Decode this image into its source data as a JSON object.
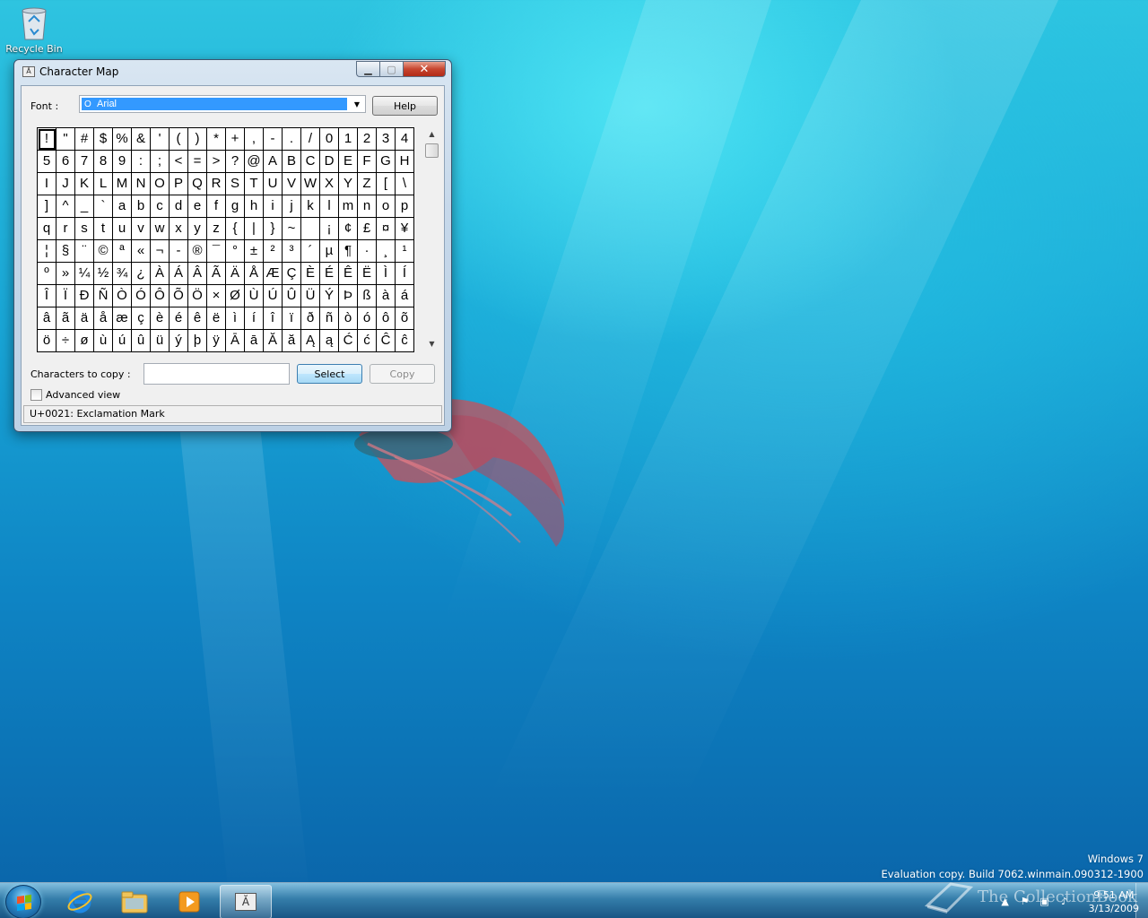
{
  "desktop": {
    "recycle_bin_label": "Recycle Bin",
    "watermark_line1": "Windows 7",
    "watermark_line2": "Evaluation copy. Build 7062.winmain.090312-1900",
    "overlay_brand": "The CollectionBook"
  },
  "window": {
    "title": "Character Map",
    "font_label": "Font :",
    "font_value": "Arial",
    "help_label": "Help",
    "chars_to_copy_label": "Characters to copy :",
    "chars_to_copy_value": "",
    "select_label": "Select",
    "copy_label": "Copy",
    "advanced_view_label": "Advanced view",
    "status_text": "U+0021: Exclamation Mark"
  },
  "grid": {
    "rows": [
      [
        "!",
        "\"",
        "#",
        "$",
        "%",
        "&",
        "'",
        "(",
        ")",
        "*",
        "+",
        ",",
        "-",
        ".",
        "/",
        "0",
        "1",
        "2",
        "3",
        "4"
      ],
      [
        "5",
        "6",
        "7",
        "8",
        "9",
        ":",
        ";",
        "<",
        "=",
        ">",
        "?",
        "@",
        "A",
        "B",
        "C",
        "D",
        "E",
        "F",
        "G",
        "H"
      ],
      [
        "I",
        "J",
        "K",
        "L",
        "M",
        "N",
        "O",
        "P",
        "Q",
        "R",
        "S",
        "T",
        "U",
        "V",
        "W",
        "X",
        "Y",
        "Z",
        "[",
        "\\"
      ],
      [
        "]",
        "^",
        "_",
        "`",
        "a",
        "b",
        "c",
        "d",
        "e",
        "f",
        "g",
        "h",
        "i",
        "j",
        "k",
        "l",
        "m",
        "n",
        "o",
        "p"
      ],
      [
        "q",
        "r",
        "s",
        "t",
        "u",
        "v",
        "w",
        "x",
        "y",
        "z",
        "{",
        "|",
        "}",
        "~",
        " ",
        "¡",
        "¢",
        "£",
        "¤",
        "¥"
      ],
      [
        "¦",
        "§",
        "¨",
        "©",
        "ª",
        "«",
        "¬",
        "-",
        "®",
        "¯",
        "°",
        "±",
        "²",
        "³",
        "´",
        "µ",
        "¶",
        "·",
        "¸",
        "¹"
      ],
      [
        "º",
        "»",
        "¼",
        "½",
        "¾",
        "¿",
        "À",
        "Á",
        "Â",
        "Ã",
        "Ä",
        "Å",
        "Æ",
        "Ç",
        "È",
        "É",
        "Ê",
        "Ë",
        "Ì",
        "Í"
      ],
      [
        "Î",
        "Ï",
        "Ð",
        "Ñ",
        "Ò",
        "Ó",
        "Ô",
        "Õ",
        "Ö",
        "×",
        "Ø",
        "Ù",
        "Ú",
        "Û",
        "Ü",
        "Ý",
        "Þ",
        "ß",
        "à",
        "á"
      ],
      [
        "â",
        "ã",
        "ä",
        "å",
        "æ",
        "ç",
        "è",
        "é",
        "ê",
        "ë",
        "ì",
        "í",
        "î",
        "ï",
        "ð",
        "ñ",
        "ò",
        "ó",
        "ô",
        "õ"
      ],
      [
        "ö",
        "÷",
        "ø",
        "ù",
        "ú",
        "û",
        "ü",
        "ý",
        "þ",
        "ÿ",
        "Ā",
        "ā",
        "Ă",
        "ă",
        "Ą",
        "ą",
        "Ć",
        "ć",
        "Ĉ",
        "ĉ"
      ]
    ]
  },
  "taskbar": {
    "pinned": [
      "start-button",
      "internet-explorer",
      "windows-explorer",
      "media-player",
      "character-map"
    ],
    "clock_time": "9:51 AM",
    "clock_date": "3/13/2009"
  }
}
